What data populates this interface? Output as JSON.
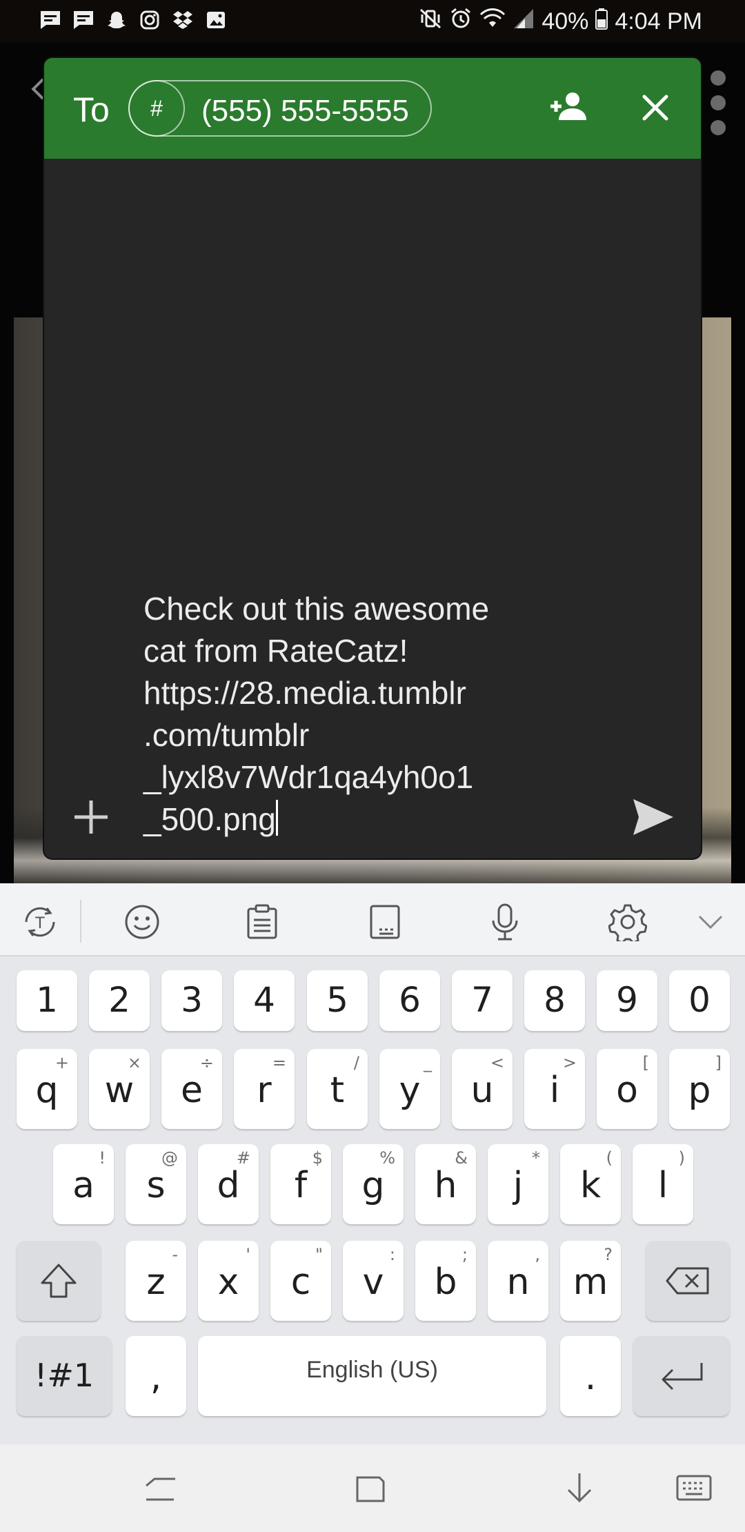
{
  "status_bar": {
    "battery": "40%",
    "time": "4:04 PM",
    "notification_icons": [
      "message-icon",
      "message-icon",
      "snapchat-icon",
      "instagram-icon",
      "dropbox-icon",
      "image-icon"
    ],
    "system_icons": [
      "vibrate-mute-icon",
      "alarm-icon",
      "wifi-icon",
      "signal-icon",
      "battery-icon"
    ]
  },
  "compose": {
    "to_label": "To",
    "recipient_avatar": "#",
    "recipient_number": "(555) 555-5555",
    "message": "Check out this awesome\ncat from RateCatz!\nhttps://28.media.tumblr\n.com/tumblr\n_lyxl8v7Wdr1qa4yh0o1\n_500.png",
    "header_color": "#2b7b2e"
  },
  "keyboard": {
    "number_row": [
      "1",
      "2",
      "3",
      "4",
      "5",
      "6",
      "7",
      "8",
      "9",
      "0"
    ],
    "row1": [
      {
        "key": "q",
        "sub": "+"
      },
      {
        "key": "w",
        "sub": "×"
      },
      {
        "key": "e",
        "sub": "÷"
      },
      {
        "key": "r",
        "sub": "="
      },
      {
        "key": "t",
        "sub": "/"
      },
      {
        "key": "y",
        "sub": "_"
      },
      {
        "key": "u",
        "sub": "<"
      },
      {
        "key": "i",
        "sub": ">"
      },
      {
        "key": "o",
        "sub": "["
      },
      {
        "key": "p",
        "sub": "]"
      }
    ],
    "row2": [
      {
        "key": "a",
        "sub": "!"
      },
      {
        "key": "s",
        "sub": "@"
      },
      {
        "key": "d",
        "sub": "#"
      },
      {
        "key": "f",
        "sub": "$"
      },
      {
        "key": "g",
        "sub": "%"
      },
      {
        "key": "h",
        "sub": "&"
      },
      {
        "key": "j",
        "sub": "*"
      },
      {
        "key": "k",
        "sub": "("
      },
      {
        "key": "l",
        "sub": ")"
      }
    ],
    "row3": [
      {
        "key": "z",
        "sub": "-"
      },
      {
        "key": "x",
        "sub": "'"
      },
      {
        "key": "c",
        "sub": "\""
      },
      {
        "key": "v",
        "sub": ":"
      },
      {
        "key": "b",
        "sub": ";"
      },
      {
        "key": "n",
        "sub": ","
      },
      {
        "key": "m",
        "sub": "?"
      }
    ],
    "symbols_label": "!#1",
    "comma_label": ",",
    "space_label": "English (US)",
    "period_label": "."
  }
}
